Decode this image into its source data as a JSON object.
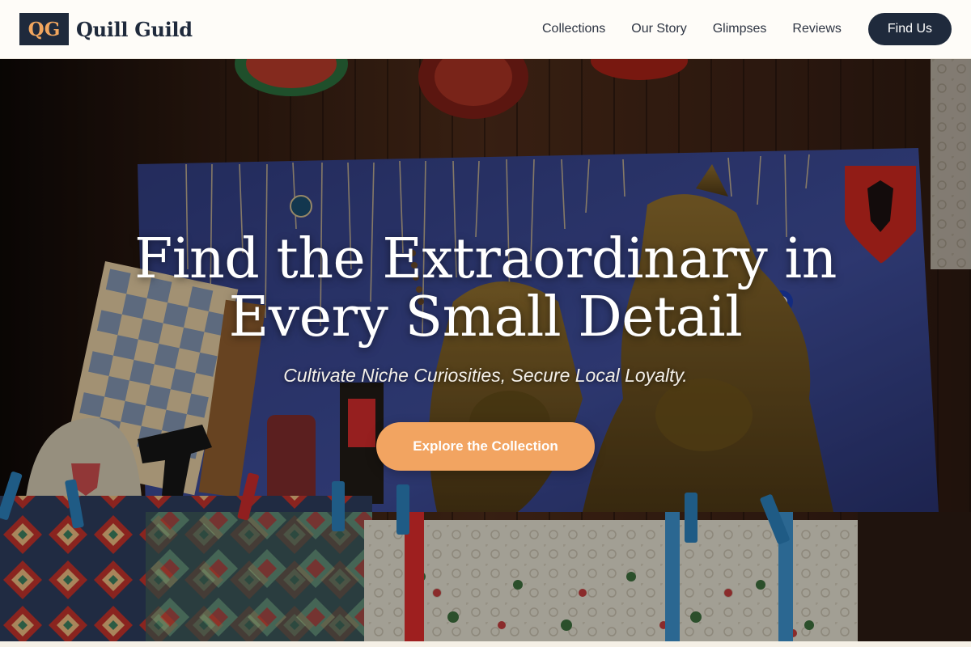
{
  "brand": {
    "logo_text": "QG",
    "name": "Quill Guild"
  },
  "nav": {
    "items": [
      {
        "label": "Collections"
      },
      {
        "label": "Our Story"
      },
      {
        "label": "Glimpses"
      },
      {
        "label": "Reviews"
      }
    ],
    "cta_label": "Find Us"
  },
  "hero": {
    "title": "Find the Extraordinary in Every Small Detail",
    "subtitle": "Cultivate Niche Curiosities, Secure Local Loyalty.",
    "button_label": "Explore the Collection",
    "background_image": "shop-display-photo"
  },
  "colors": {
    "brand_navy": "#1f2a3c",
    "accent_orange": "#f2a461",
    "header_bg": "#fefcf8"
  }
}
